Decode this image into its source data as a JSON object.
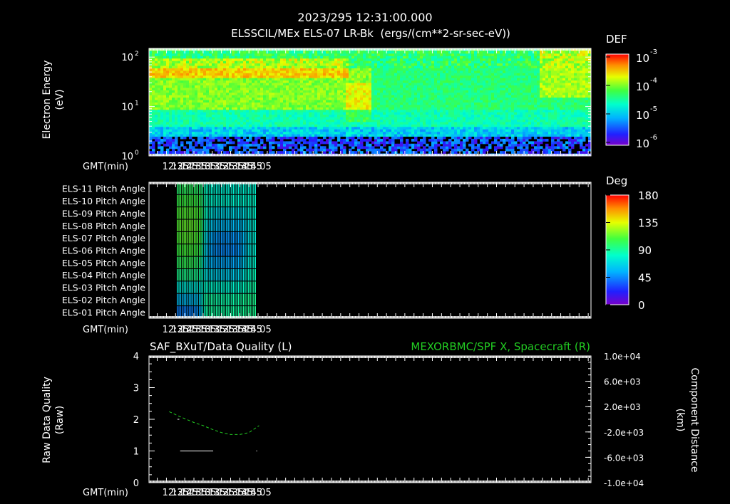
{
  "header": {
    "timestamp": "2023/295 12:31:00.000",
    "subtitle": "ELSSCIL/MEx ELS-07 LR-Bk  (ergs/(cm**2-sr-sec-eV))"
  },
  "colors": {
    "background": "#000000",
    "foreground": "#ffffff",
    "spacecraft_trace": "#22cc22",
    "grid": "#000000"
  },
  "time_axis": {
    "label": "GMT(min)",
    "ticks": [
      "12:35",
      "12:45",
      "12:55",
      "13:05",
      "13:15",
      "13:25",
      "13:35",
      "13:45",
      "13:55",
      "14:05"
    ]
  },
  "chart_data": [
    {
      "type": "heatmap",
      "name": "ELS-07 energy spectrogram",
      "ylabel": "Electron Energy (eV)",
      "ylabel_lines": [
        "Electron Energy",
        "(eV)"
      ],
      "yscale": "log",
      "y_ticks": [
        {
          "base": "10",
          "exp": "0",
          "value": 1
        },
        {
          "base": "10",
          "exp": "1",
          "value": 10
        },
        {
          "base": "10",
          "exp": "2",
          "value": 100
        }
      ],
      "ylim": [
        1,
        150
      ],
      "x_ticks": [
        "12:35",
        "12:45",
        "12:55",
        "13:05",
        "13:15",
        "13:25",
        "13:35",
        "13:45",
        "13:55",
        "14:05"
      ],
      "xlim_minutes": [
        726,
        1208
      ],
      "colorbar": {
        "title": "DEF",
        "scale": "log",
        "labels": [
          {
            "base": "10",
            "exp": "-3",
            "value": 0.001
          },
          {
            "base": "10",
            "exp": "-4",
            "value": 0.0001
          },
          {
            "base": "10",
            "exp": "-5",
            "value": 1e-05
          },
          {
            "base": "10",
            "exp": "-6",
            "value": 1e-06
          }
        ]
      }
    },
    {
      "type": "heatmap",
      "name": "Pitch angle",
      "rows": [
        "ELS-11 Pitch Angle",
        "ELS-10 Pitch Angle",
        "ELS-09 Pitch Angle",
        "ELS-08 Pitch Angle",
        "ELS-07 Pitch Angle",
        "ELS-06 Pitch Angle",
        "ELS-05 Pitch Angle",
        "ELS-04 Pitch Angle",
        "ELS-03 Pitch Angle",
        "ELS-02 Pitch Angle",
        "ELS-01 Pitch Angle"
      ],
      "x_ticks": [
        "12:35",
        "12:45",
        "12:55",
        "13:05",
        "13:15",
        "13:25",
        "13:35",
        "13:45",
        "13:55",
        "14:05"
      ],
      "colorbar": {
        "title": "Deg",
        "labels": [
          "180",
          "135",
          "90",
          "45",
          "0"
        ],
        "range": [
          0,
          180
        ]
      },
      "time_range": [
        "12:36",
        "14:03"
      ],
      "values_deg": [
        [
          98,
          99,
          100,
          101,
          101,
          101,
          101,
          101,
          101,
          101,
          100,
          100,
          99,
          97,
          95,
          90,
          85,
          82,
          80,
          80,
          79,
          78,
          78,
          77,
          77,
          77,
          77,
          77,
          77,
          77,
          77,
          77,
          77,
          77,
          77,
          77,
          77,
          77,
          77,
          77,
          78,
          78,
          78,
          78,
          78,
          78,
          78
        ],
        [
          105,
          106,
          107,
          107,
          107,
          107,
          107,
          107,
          107,
          107,
          107,
          106,
          105,
          103,
          100,
          93,
          87,
          84,
          82,
          81,
          80,
          79,
          79,
          78,
          78,
          78,
          78,
          78,
          78,
          78,
          78,
          78,
          78,
          78,
          78,
          78,
          78,
          78,
          78,
          78,
          79,
          79,
          79,
          80,
          80,
          80,
          80
        ],
        [
          110,
          111,
          112,
          112,
          112,
          112,
          112,
          112,
          112,
          112,
          112,
          111,
          110,
          108,
          104,
          95,
          87,
          82,
          78,
          75,
          72,
          70,
          69,
          68,
          67,
          67,
          67,
          67,
          67,
          67,
          67,
          67,
          67,
          67,
          67,
          67,
          67,
          67,
          68,
          69,
          71,
          73,
          75,
          76,
          77,
          78,
          78
        ],
        [
          112,
          113,
          114,
          115,
          115,
          115,
          115,
          115,
          115,
          115,
          114,
          113,
          112,
          109,
          104,
          92,
          82,
          75,
          70,
          66,
          62,
          60,
          59,
          58,
          57,
          57,
          57,
          57,
          57,
          57,
          57,
          57,
          57,
          57,
          57,
          57,
          58,
          59,
          60,
          62,
          65,
          68,
          71,
          73,
          75,
          76,
          76
        ],
        [
          110,
          111,
          112,
          113,
          113,
          113,
          113,
          113,
          113,
          113,
          112,
          111,
          110,
          107,
          101,
          88,
          76,
          68,
          62,
          57,
          53,
          51,
          50,
          49,
          48,
          48,
          48,
          48,
          48,
          48,
          48,
          48,
          48,
          48,
          48,
          49,
          50,
          52,
          54,
          57,
          61,
          65,
          69,
          72,
          74,
          75,
          75
        ],
        [
          106,
          107,
          108,
          109,
          109,
          109,
          109,
          109,
          109,
          109,
          108,
          107,
          106,
          103,
          97,
          84,
          72,
          64,
          58,
          54,
          51,
          49,
          48,
          47,
          46,
          46,
          46,
          46,
          46,
          46,
          46,
          46,
          46,
          46,
          46,
          47,
          48,
          50,
          53,
          57,
          61,
          66,
          70,
          73,
          75,
          76,
          76
        ],
        [
          100,
          101,
          102,
          103,
          103,
          103,
          103,
          103,
          103,
          102,
          101,
          100,
          98,
          95,
          90,
          79,
          70,
          64,
          60,
          57,
          55,
          54,
          53,
          52,
          52,
          52,
          52,
          52,
          52,
          52,
          52,
          52,
          52,
          52,
          52,
          53,
          54,
          56,
          59,
          62,
          66,
          70,
          73,
          76,
          78,
          79,
          79
        ],
        [
          92,
          93,
          93,
          93,
          93,
          93,
          93,
          93,
          93,
          93,
          93,
          92,
          91,
          89,
          86,
          79,
          74,
          71,
          69,
          67,
          66,
          65,
          64,
          64,
          63,
          63,
          63,
          63,
          63,
          63,
          63,
          63,
          63,
          63,
          64,
          64,
          65,
          67,
          69,
          72,
          75,
          78,
          80,
          82,
          83,
          84,
          84
        ],
        [
          74,
          74,
          74,
          74,
          74,
          74,
          74,
          74,
          74,
          74,
          74,
          74,
          74,
          74,
          76,
          79,
          80,
          80,
          80,
          80,
          80,
          79,
          79,
          79,
          78,
          78,
          78,
          78,
          78,
          78,
          78,
          78,
          78,
          78,
          78,
          78,
          79,
          80,
          81,
          82,
          83,
          84,
          86,
          87,
          87,
          88,
          88
        ],
        [
          58,
          58,
          58,
          58,
          58,
          58,
          58,
          58,
          58,
          58,
          59,
          60,
          61,
          64,
          70,
          81,
          86,
          88,
          89,
          89,
          89,
          88,
          88,
          88,
          87,
          87,
          87,
          87,
          87,
          87,
          87,
          87,
          87,
          87,
          87,
          87,
          88,
          89,
          89,
          90,
          91,
          91,
          92,
          92,
          92,
          92,
          92
        ],
        [
          43,
          43,
          43,
          43,
          43,
          44,
          44,
          44,
          44,
          44,
          45,
          46,
          48,
          52,
          60,
          75,
          83,
          87,
          89,
          90,
          90,
          89,
          89,
          89,
          89,
          89,
          89,
          89,
          89,
          89,
          89,
          89,
          89,
          89,
          89,
          89,
          89,
          90,
          90,
          91,
          91,
          91,
          92,
          92,
          92,
          92,
          92
        ]
      ]
    },
    {
      "type": "line",
      "name": "Data quality and spacecraft position",
      "title_left": "SAF_BXuT/Data Quality (L)",
      "title_right": "MEXORBMC/SPF X, Spacecraft (R)",
      "ylabel_left_lines": [
        "Raw Data Quality",
        "(Raw)"
      ],
      "ylabel_right_lines": [
        "Component Distance",
        "(km)"
      ],
      "ylim_left": [
        0,
        4
      ],
      "y_ticks_left": [
        "0",
        "1",
        "2",
        "3",
        "4"
      ],
      "ylim_right": [
        -10000,
        10000
      ],
      "y_ticks_right": [
        "-1.0e+04",
        "-6.0e+03",
        "-2.0e+03",
        "2.0e+03",
        "6.0e+03",
        "1.0e+04"
      ],
      "x_ticks": [
        "12:35",
        "12:45",
        "12:55",
        "13:05",
        "13:15",
        "13:25",
        "13:35",
        "13:45",
        "13:55",
        "14:05"
      ],
      "series": [
        {
          "axis": "left",
          "style": "segments",
          "segments": [
            {
              "x_start": "12:37",
              "x_end": "12:39",
              "y": 2
            },
            {
              "x_start": "12:40",
              "x_end": "13:16",
              "y": 1
            },
            {
              "x_start": "13:17",
              "x_end": "14:03",
              "y": 0
            },
            {
              "x_start": "14:03",
              "x_end": "14:04",
              "y": 1
            }
          ]
        },
        {
          "axis": "right",
          "style": "dashed",
          "x": [
            "12:28",
            "12:40",
            "12:55",
            "13:05",
            "13:15",
            "13:25",
            "13:35",
            "13:45",
            "13:55",
            "14:06"
          ],
          "y": [
            1200,
            400,
            -500,
            -1000,
            -1600,
            -2100,
            -2400,
            -2400,
            -2100,
            -1000
          ]
        }
      ]
    }
  ]
}
